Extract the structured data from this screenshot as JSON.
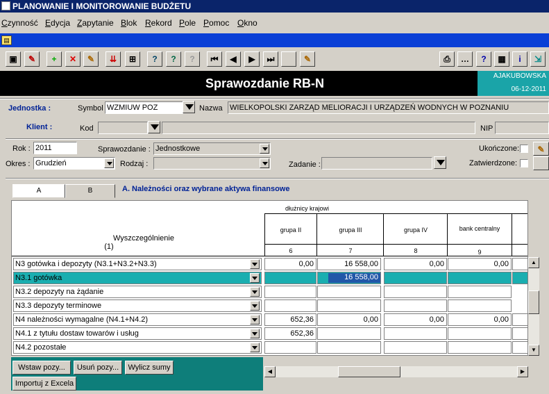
{
  "window": {
    "title": "PLANOWANIE I MONITOROWANIE BUDŻETU"
  },
  "menu": [
    "Czynność",
    "Edycja",
    "Zapytanie",
    "Blok",
    "Rekord",
    "Pole",
    "Pomoc",
    "Okno"
  ],
  "header": {
    "title": "Sprawozdanie RB-N",
    "user": "AJAKUBOWSKA",
    "date": "06-12-2011"
  },
  "jednostka": {
    "label": "Jednostka :",
    "symbol_label": "Symbol",
    "symbol": "WZMIUW POZ",
    "nazwa_label": "Nazwa",
    "nazwa": "WIELKOPOLSKI ZARZĄD MELIORACJI I URZĄDZEŃ WODNYCH W POZNANIU"
  },
  "klient": {
    "label": "Klient :",
    "kod_label": "Kod",
    "kod": "",
    "nip_label": "NIP",
    "nip": ""
  },
  "filters": {
    "rok_label": "Rok :",
    "rok": "2011",
    "sprawozdanie_label": "Sprawozdanie :",
    "sprawozdanie": "Jednostkowe",
    "okres_label": "Okres :",
    "okres": "Grudzień",
    "rodzaj_label": "Rodzaj :",
    "rodzaj": "",
    "zadanie_label": "Zadanie :",
    "zadanie": "",
    "ukonczone_label": "Ukończone:",
    "zatwierdzone_label": "Zatwierdzone:"
  },
  "tabs": [
    "A",
    "B"
  ],
  "section_title": "A. Należności oraz wybrane aktywa finansowe",
  "table": {
    "group_header": "dłużnicy krajowi",
    "label_header": "Wyszczególnienie",
    "label_num": "(1)",
    "columns": [
      {
        "name": "grupa II",
        "num": "6"
      },
      {
        "name": "grupa III",
        "num": "7"
      },
      {
        "name": "grupa IV",
        "num": "8"
      },
      {
        "name": "bank centralny",
        "num": "9"
      }
    ],
    "rows": [
      {
        "label": "N3 gotówka i depozyty (N3.1+N3.2+N3.3)",
        "values": [
          "0,00",
          "16 558,00",
          "0,00",
          "0,00"
        ]
      },
      {
        "label": "N3.1 gotówka",
        "values": [
          "",
          "16 558,00",
          "",
          ""
        ]
      },
      {
        "label": "N3.2 depozyty na żądanie",
        "values": [
          "",
          "",
          "",
          ""
        ]
      },
      {
        "label": "N3.3 depozyty terminowe",
        "values": [
          "",
          "",
          "",
          ""
        ]
      },
      {
        "label": "N4 należności wymagalne (N4.1+N4.2)",
        "values": [
          "652,36",
          "0,00",
          "0,00",
          "0,00"
        ]
      },
      {
        "label": "N4.1 z tytułu dostaw towarów i usług",
        "values": [
          "652,36",
          "",
          "",
          ""
        ]
      },
      {
        "label": "N4.2 pozostałe",
        "values": [
          "",
          "",
          "",
          ""
        ]
      }
    ]
  },
  "buttons": {
    "wstaw": "Wstaw pozy...",
    "usun": "Usuń pozy...",
    "wylicz": "Wylicz sumy",
    "import": "Importuj z Excela"
  },
  "toolbar_icons": [
    "save-icon",
    "edit-icon",
    "add-icon",
    "delete-icon",
    "clear-icon",
    "insert-row-icon",
    "duplicate-icon",
    "query-icon",
    "search-icon",
    "refresh-icon",
    "first-record-icon",
    "prev-record-icon",
    "next-record-icon",
    "last-record-icon",
    "blank-icon",
    "notes-icon",
    "print-icon",
    "dots-icon",
    "help-icon",
    "calculator-icon",
    "info-icon",
    "exit-icon"
  ]
}
